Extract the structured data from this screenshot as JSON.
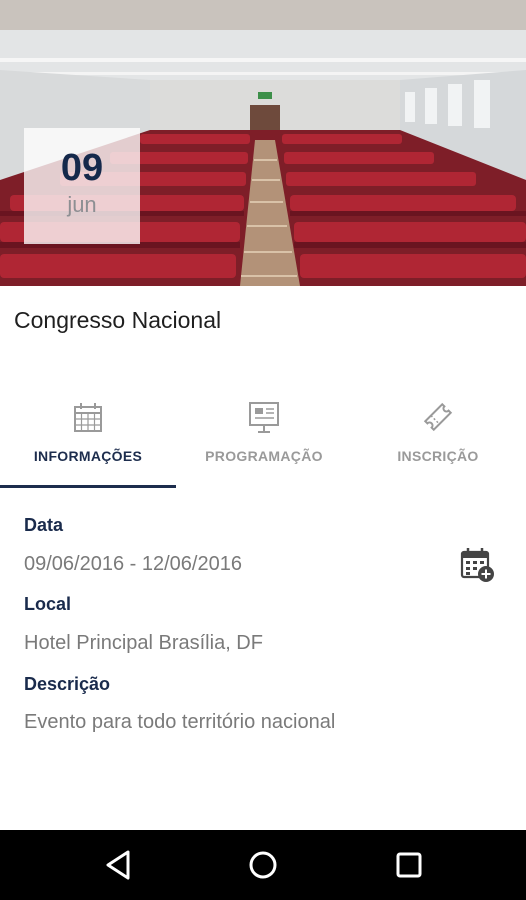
{
  "event": {
    "day": "09",
    "month": "jun",
    "title": "Congresso Nacional"
  },
  "tabs": [
    {
      "label": "INFORMAÇÕES",
      "icon": "calendar-icon",
      "active": true
    },
    {
      "label": "PROGRAMAÇÃO",
      "icon": "presentation-icon",
      "active": false
    },
    {
      "label": "INSCRIÇÃO",
      "icon": "ticket-icon",
      "active": false
    }
  ],
  "details": {
    "date_label": "Data",
    "date_value": "09/06/2016 - 12/06/2016",
    "location_label": "Local",
    "location_value": "Hotel Principal Brasília, DF",
    "description_label": "Descrição",
    "description_value": "Evento para todo território nacional"
  },
  "nav": {
    "back_icon": "back-triangle-icon",
    "home_icon": "home-circle-icon",
    "recents_icon": "recents-square-icon"
  },
  "colors": {
    "accent": "#1d2d4d",
    "inactive": "#9a9a9a",
    "seat_red": "#a11d2b"
  }
}
